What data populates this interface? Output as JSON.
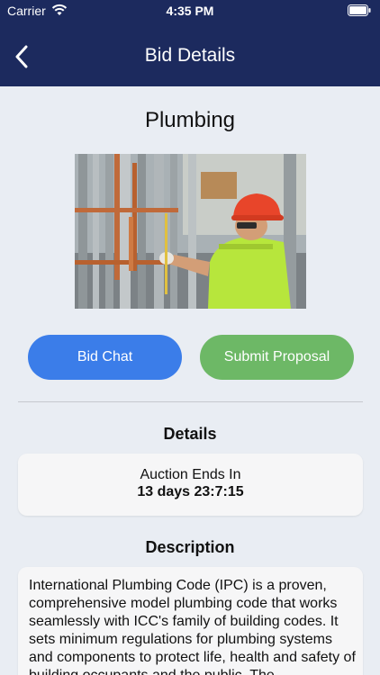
{
  "status_bar": {
    "carrier": "Carrier",
    "time": "4:35 PM",
    "wifi_icon": "wifi-icon",
    "battery_icon": "battery-icon"
  },
  "nav": {
    "title": "Bid Details",
    "back_icon": "chevron-left-icon",
    "background_color": "#1c2a5e"
  },
  "bid": {
    "title": "Plumbing",
    "image_description_icon": "plumbing-worker-photo"
  },
  "actions": {
    "chat_label": "Bid Chat",
    "chat_color": "#3b7de9",
    "proposal_label": "Submit Proposal",
    "proposal_color": "#6db866"
  },
  "details": {
    "heading": "Details",
    "auction_label": "Auction Ends In",
    "auction_value": "13 days 23:7:15"
  },
  "description": {
    "heading": "Description",
    "text": "International Plumbing Code (IPC) is a proven, comprehensive model plumbing code that works seamlessly with ICC's family of building codes. It sets minimum regulations for plumbing systems and components to protect life, health and safety of building occupants and the public. The"
  }
}
